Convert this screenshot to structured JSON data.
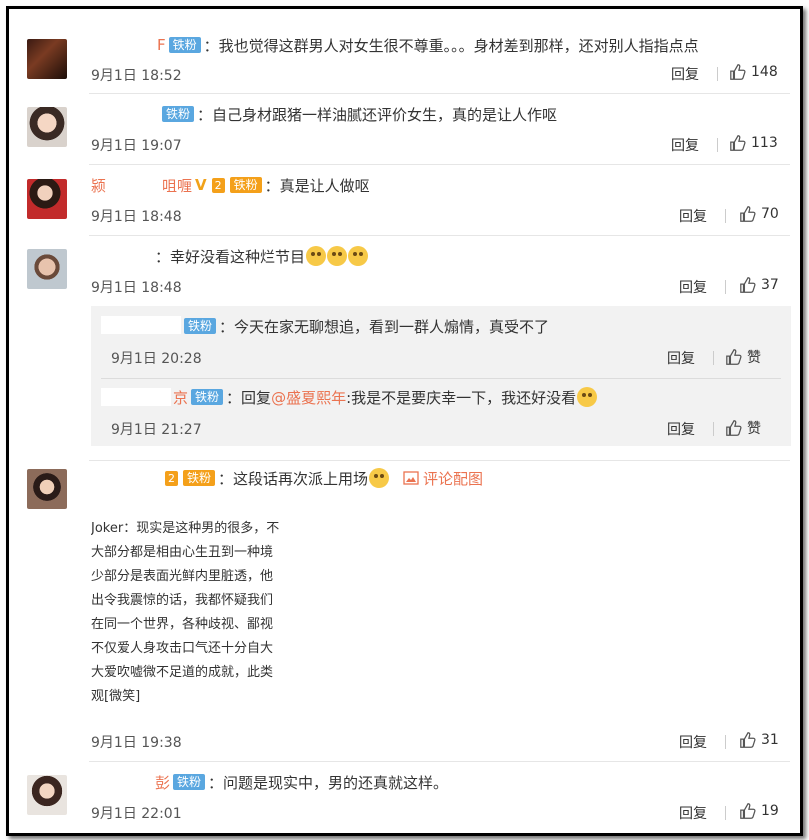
{
  "comments": [
    {
      "user_suffix": "F",
      "badge": "铁粉",
      "text": "我也觉得这群男人对女生很不尊重。。。身材差到那样，还对别人指指点点",
      "time": "9月1日 18:52",
      "reply": "回复",
      "likes": "148"
    },
    {
      "user_suffix": "",
      "badge": "铁粉",
      "text": "自己身材跟猪一样油腻还评价女生，真的是让人作呕",
      "time": "9月1日 19:07",
      "reply": "回复",
      "likes": "113"
    },
    {
      "user_prefix": "颍",
      "user_suffix": "咀喱",
      "vip_level": "2",
      "badge": "铁粉",
      "text": "真是让人做呕",
      "time": "9月1日 18:48",
      "reply": "回复",
      "likes": "70"
    },
    {
      "user_suffix": "",
      "text": "幸好没看这种烂节目",
      "time": "9月1日 18:48",
      "reply": "回复",
      "likes": "37"
    },
    {
      "user_suffix": "",
      "vip_level": "2",
      "badge": "铁粉",
      "text": "这段话再次派上用场",
      "pic_link": "评论配图",
      "time": "9月1日 19:38",
      "reply": "回复",
      "likes": "31",
      "image_lines": [
        "Joker：现实是这种男的很多，不",
        "大部分都是相由心生丑到一种境",
        "少部分是表面光鲜内里脏透，他",
        "出令我震惊的话，我都怀疑我们",
        "在同一个世界，各种歧视、鄙视",
        "不仅爱人身攻击口气还十分自大",
        "大爱吹嘘微不足道的成就，此类",
        "观[微笑]"
      ]
    },
    {
      "user_suffix": "彭",
      "badge": "铁粉",
      "text": "问题是现实中，男的还真就这样。",
      "time": "9月1日 22:01",
      "reply": "回复",
      "likes": "19"
    }
  ],
  "replies": [
    {
      "badge": "铁粉",
      "text": "今天在家无聊想追，看到一群人煽情，真受不了",
      "time": "9月1日 20:28",
      "reply": "回复",
      "likes": "赞"
    },
    {
      "user_suffix": "京",
      "badge": "铁粉",
      "prefix": "回复",
      "mention": "@盛夏熙年",
      "text": ":我是不是要庆幸一下，我还好没看",
      "time": "9月1日 21:27",
      "reply": "回复",
      "likes": "赞"
    }
  ]
}
